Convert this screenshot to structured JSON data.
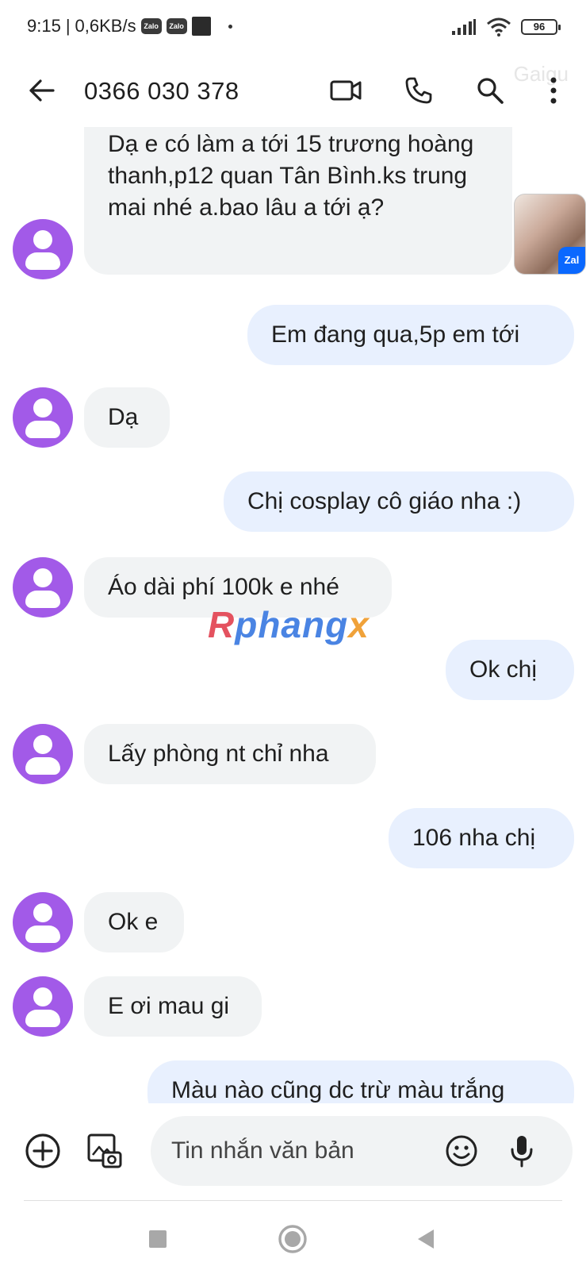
{
  "status_bar": {
    "time": "9:15",
    "separator": "|",
    "speed": "0,6KB/s",
    "notif_1": "Zalo",
    "notif_2": "Zalo",
    "battery": "96"
  },
  "header": {
    "title": "0366 030 378",
    "watermark": "Gaigu"
  },
  "messages": [
    {
      "dir": "in",
      "text": "Dạ e có làm a tới 15 trương hoàng thanh,p12 quan Tân Bình.ks trung mai nhé a.bao lâu a tới ạ?"
    },
    {
      "dir": "out",
      "text": "Em đang qua,5p em tới"
    },
    {
      "dir": "in",
      "text": "Dạ"
    },
    {
      "dir": "out",
      "text": "Chị cosplay cô giáo nha :)"
    },
    {
      "dir": "in",
      "text": "Áo dài phí 100k e nhé"
    },
    {
      "dir": "out",
      "text": "Ok chị"
    },
    {
      "dir": "in",
      "text": "Lấy phòng nt chỉ nha"
    },
    {
      "dir": "out",
      "text": "106 nha chị"
    },
    {
      "dir": "in",
      "text": "Ok e"
    },
    {
      "dir": "in",
      "text": "E ơi mau gi"
    },
    {
      "dir": "out",
      "text": "Màu nào cũng dc trừ màu trắng"
    }
  ],
  "thumbnail_badge": "Zal",
  "brand_watermark": {
    "p1": "R",
    "p2": "phang",
    "p3": "x"
  },
  "composer": {
    "placeholder": "Tin nhắn văn bản"
  },
  "colors": {
    "avatar": "#a25ae8",
    "incoming_bubble": "#f1f3f4",
    "outgoing_bubble": "#e8f0fe"
  },
  "icons": {
    "back": "arrow-left-icon",
    "video": "video-camera-icon",
    "phone": "phone-icon",
    "search": "search-icon",
    "more": "more-vert-icon",
    "add": "add-circle-icon",
    "gallery": "gallery-icon",
    "emoji": "emoji-icon",
    "mic": "mic-icon",
    "nav_recents": "square-icon",
    "nav_home": "circle-icon",
    "nav_back": "triangle-back-icon"
  }
}
